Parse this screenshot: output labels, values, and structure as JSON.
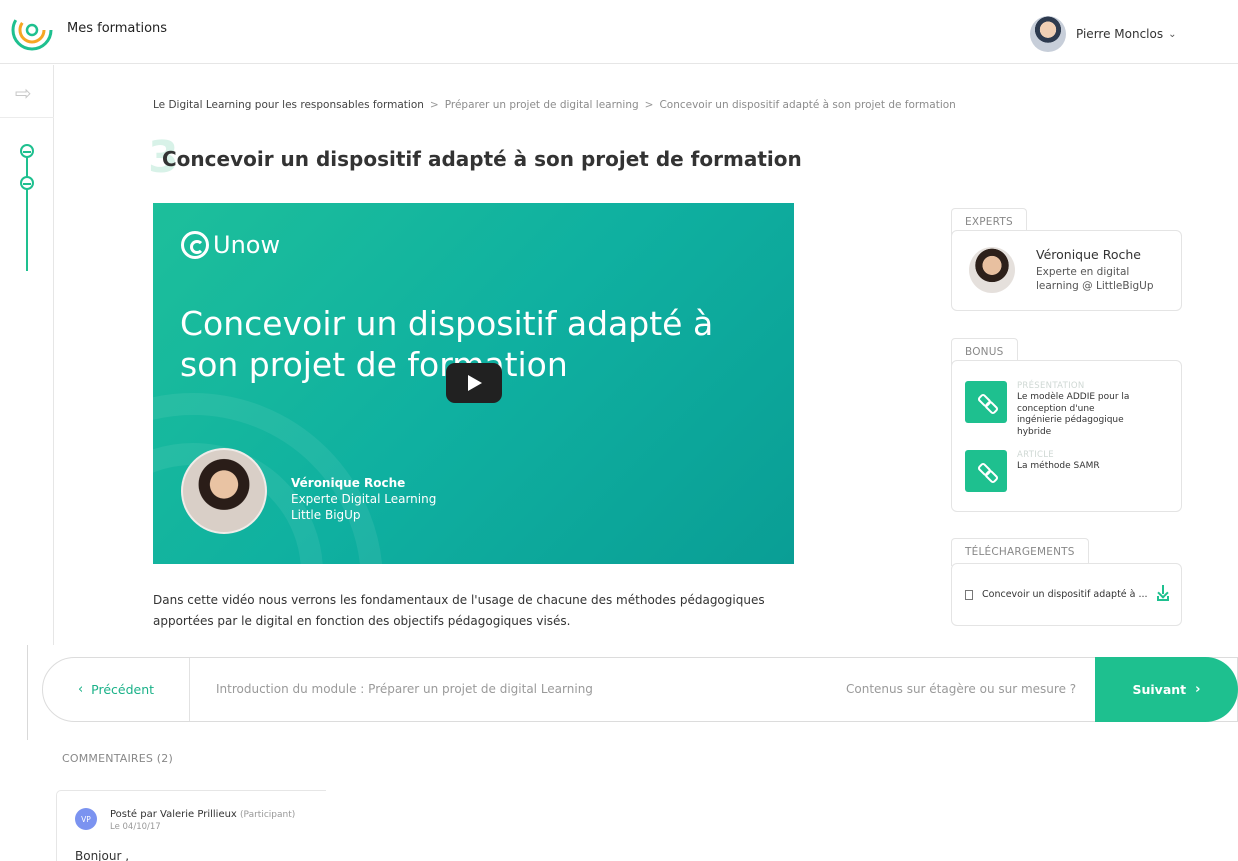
{
  "header": {
    "app_title": "Mes formations",
    "user_name": "Pierre Monclos"
  },
  "breadcrumb": {
    "items": [
      "Le Digital Learning pour les responsables formation",
      "Préparer un projet de digital learning",
      "Concevoir un dispositif adapté à son projet de formation"
    ]
  },
  "lesson": {
    "chapter_number": "3",
    "title": "Concevoir un dispositif adapté à son projet de formation",
    "description": "Dans cette vidéo nous verrons les fondamentaux de l'usage de chacune des méthodes pédagogiques apportées par le digital en fonction des objectifs pédagogiques visés."
  },
  "video": {
    "brand": "Unow",
    "title": "Concevoir un dispositif adapté à son projet de formation",
    "speaker_name": "Véronique Roche",
    "speaker_role": "Experte Digital Learning",
    "speaker_company": "Little BigUp"
  },
  "experts": {
    "tab_label": "EXPERTS",
    "name": "Véronique Roche",
    "role": "Experte en digital learning @ LittleBigUp"
  },
  "bonus": {
    "tab_label": "BONUS",
    "items": [
      {
        "type": "PRÉSENTATION",
        "title": "Le modèle ADDIE pour la conception d'une ingénierie pédagogique hybride"
      },
      {
        "type": "ARTICLE",
        "title": "La méthode SAMR"
      }
    ]
  },
  "downloads": {
    "tab_label": "TÉLÉCHARGEMENTS",
    "file_label": "Concevoir un dispositif adapté à ..."
  },
  "navigation": {
    "prev_label": "Précédent",
    "prev_arrow": "‹",
    "prev_title": "Introduction du module : Préparer un projet de digital Learning",
    "next_title": "Contenus sur étagère ou sur mesure ?",
    "next_label": "Suivant",
    "next_arrow": "›"
  },
  "comments": {
    "heading": "COMMENTAIRES (2)",
    "items": [
      {
        "initials": "VP",
        "posted_by": "Posté par Valerie Prillieux",
        "role": "(Participant)",
        "date": "Le 04/10/17",
        "body": "Bonjour ,"
      }
    ]
  },
  "colors": {
    "accent": "#1ec08f",
    "avatar_comment": "#7b93f0"
  }
}
